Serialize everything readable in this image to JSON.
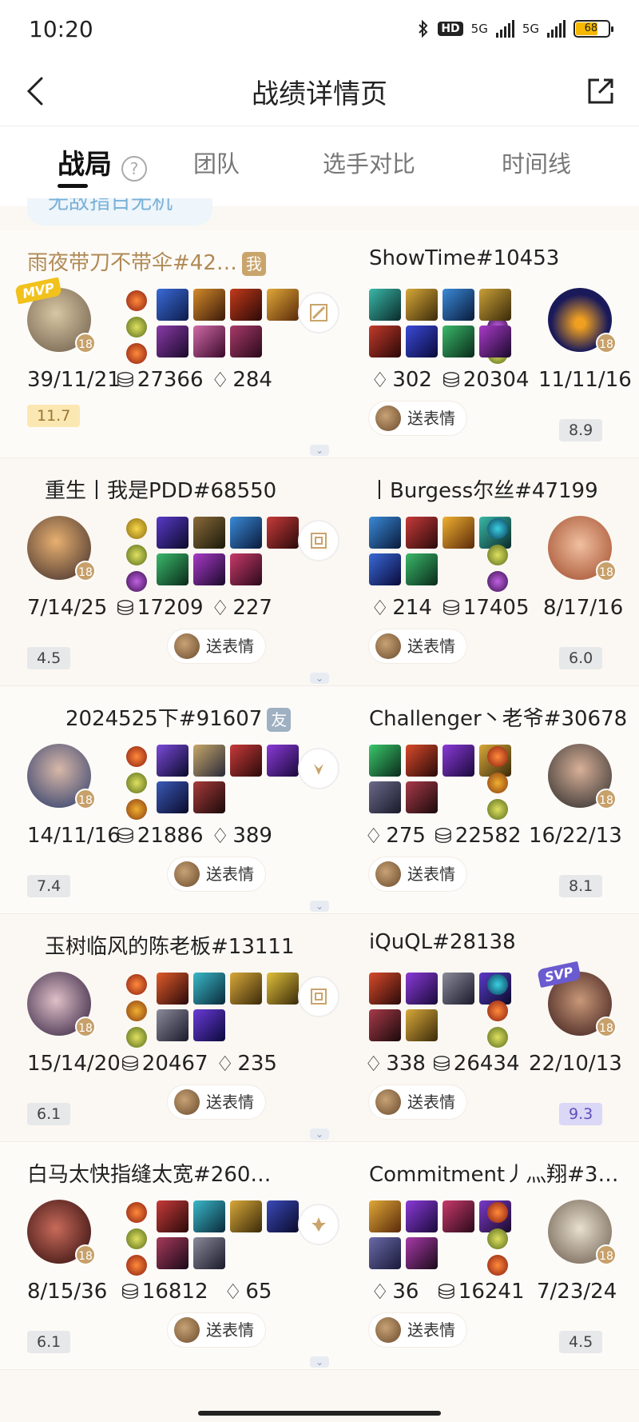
{
  "status_bar": {
    "time": "10:20",
    "hd": "HD",
    "net1": "5G",
    "net2": "5G",
    "battery": "68"
  },
  "header": {
    "title": "战绩详情页"
  },
  "tabs": [
    {
      "label": "战局",
      "active": true
    },
    {
      "label": "团队",
      "active": false
    },
    {
      "label": "选手对比",
      "active": false
    },
    {
      "label": "时间线",
      "active": false
    }
  ],
  "info_pill": "无敌指日无机",
  "matchups": [
    {
      "left": {
        "name": "雨夜带刀不带伞#42…",
        "tag": "我",
        "tag_type": "me",
        "badge": "MVP",
        "level": "18",
        "kda": "39/11/21",
        "gold": "27366",
        "cs": "284",
        "score": "11.7",
        "score_style": "gold",
        "emote": ""
      },
      "right": {
        "name": "ShowTime#10453",
        "tag": "",
        "badge": "",
        "level": "18",
        "kda": "11/11/16",
        "gold": "20304",
        "cs": "302",
        "score": "8.9",
        "score_style": "grey",
        "emote": "送表情"
      }
    },
    {
      "left": {
        "name": "重生丨我是PDD#68550",
        "tag": "",
        "badge": "",
        "level": "18",
        "kda": "7/14/25",
        "gold": "17209",
        "cs": "227",
        "score": "4.5",
        "score_style": "grey",
        "emote": "送表情"
      },
      "right": {
        "name": "丨Burgess尔丝#47199",
        "tag": "",
        "badge": "",
        "level": "18",
        "kda": "8/17/16",
        "gold": "17405",
        "cs": "214",
        "score": "6.0",
        "score_style": "grey",
        "emote": "送表情"
      }
    },
    {
      "left": {
        "name": "2024525下#91607",
        "tag": "友",
        "tag_type": "friend",
        "badge": "",
        "level": "18",
        "kda": "14/11/16",
        "gold": "21886",
        "cs": "389",
        "score": "7.4",
        "score_style": "grey",
        "emote": "送表情"
      },
      "right": {
        "name": "Challenger丶老爷#30678",
        "tag": "",
        "badge": "",
        "level": "18",
        "kda": "16/22/13",
        "gold": "22582",
        "cs": "275",
        "score": "8.1",
        "score_style": "grey",
        "emote": "送表情"
      }
    },
    {
      "left": {
        "name": "玉树临风的陈老板#13111",
        "tag": "",
        "badge": "",
        "level": "18",
        "kda": "15/14/20",
        "gold": "20467",
        "cs": "235",
        "score": "6.1",
        "score_style": "grey",
        "emote": "送表情"
      },
      "right": {
        "name": "iQuQL#28138",
        "tag": "",
        "badge": "SVP",
        "level": "18",
        "kda": "22/10/13",
        "gold": "26434",
        "cs": "338",
        "score": "9.3",
        "score_style": "purple",
        "emote": "送表情"
      }
    },
    {
      "left": {
        "name": "白马太快指缝太宽#260…",
        "tag": "",
        "badge": "",
        "level": "18",
        "kda": "8/15/36",
        "gold": "16812",
        "cs": "65",
        "score": "6.1",
        "score_style": "grey",
        "emote": "送表情"
      },
      "right": {
        "name": "Commitment丿灬翔#3…",
        "tag": "",
        "badge": "",
        "level": "18",
        "kda": "7/23/24",
        "gold": "16241",
        "cs": "36",
        "score": "4.5",
        "score_style": "grey",
        "emote": "送表情"
      }
    }
  ],
  "colors": {
    "accent_gold": "#c9a46b",
    "mvp": "#f2c21c",
    "svp": "#6b5bd0"
  }
}
